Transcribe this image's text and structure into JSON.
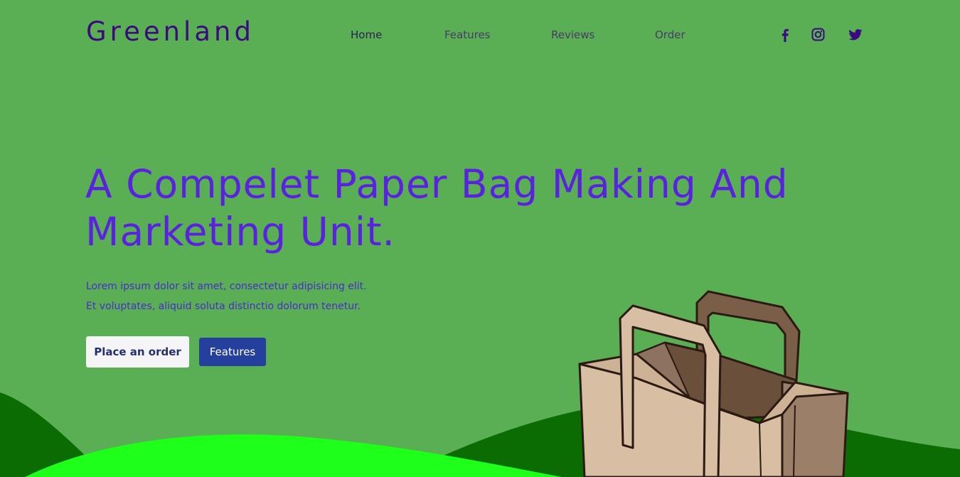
{
  "brand": {
    "name": "Greenland"
  },
  "nav": {
    "items": [
      {
        "label": "Home",
        "active": true
      },
      {
        "label": "Features",
        "active": false
      },
      {
        "label": "Reviews",
        "active": false
      },
      {
        "label": "Order",
        "active": false
      }
    ]
  },
  "social": [
    {
      "icon": "facebook-icon"
    },
    {
      "icon": "instagram-icon"
    },
    {
      "icon": "twitter-icon"
    }
  ],
  "hero": {
    "headline": "A Compelet Paper Bag Making And Marketing Unit.",
    "lines": [
      "Lorem ipsum dolor sit amet, consectetur adipisicing elit.",
      "Et voluptates, aliquid soluta distinctio dolorum tenetur."
    ],
    "primary_button": "Place an order",
    "secondary_button": "Features"
  },
  "colors": {
    "background": "#5aaf55",
    "hill_dark": "#0b6c04",
    "hill_bright": "#1eff1a",
    "brand": "#3b0a7d",
    "headline": "#5a22e0",
    "button_secondary": "#25409c"
  }
}
